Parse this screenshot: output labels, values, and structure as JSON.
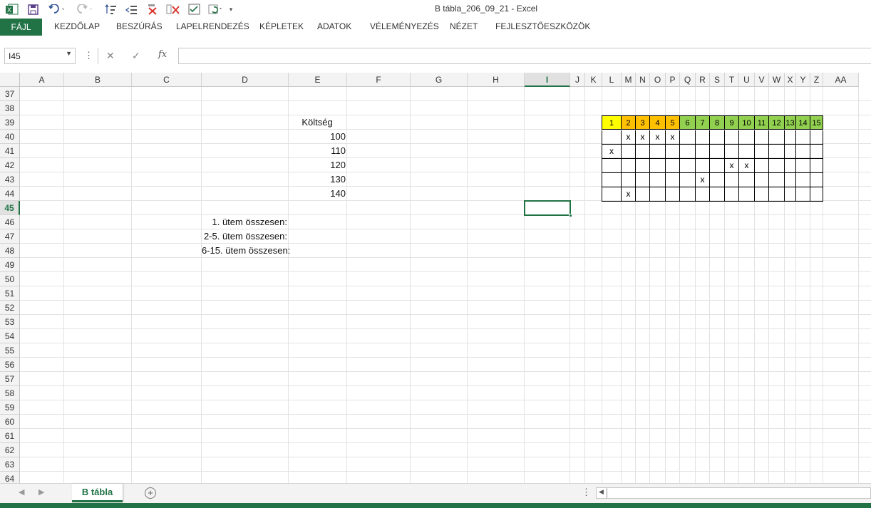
{
  "window": {
    "title": "B tábla_206_09_21 - Excel"
  },
  "ribbon": {
    "file_tab": "FÁJL",
    "tabs": [
      "KEZDŐLAP",
      "BESZÚRÁS",
      "LAPELRENDEZÉS",
      "KÉPLETEK",
      "ADATOK",
      "VÉLEMÉNYEZÉS",
      "NÉZET",
      "FEJLESZTŐESZKÖZÖK"
    ]
  },
  "quick_access": [
    "excel-logo-icon",
    "save-icon",
    "undo-icon",
    "redo-icon",
    "sort-icon",
    "indent-icon",
    "delete-icon",
    "delete-icon",
    "checklist-icon",
    "refresh-icon",
    "more-icon"
  ],
  "formula_bar": {
    "name_box": "I45",
    "fx": "fx",
    "formula": ""
  },
  "columns": [
    "A",
    "B",
    "C",
    "D",
    "E",
    "F",
    "G",
    "H",
    "I",
    "J",
    "K",
    "L",
    "M",
    "N",
    "O",
    "P",
    "Q",
    "R",
    "S",
    "T",
    "U",
    "V",
    "W",
    "X",
    "Y",
    "Z",
    "AA"
  ],
  "selected_column": "I",
  "rows": [
    37,
    38,
    39,
    40,
    41,
    42,
    43,
    44,
    45,
    46,
    47,
    48,
    49,
    50,
    51,
    52,
    53,
    54,
    55,
    56,
    57,
    58,
    59,
    60,
    61,
    62,
    63,
    64
  ],
  "selected_row": 45,
  "selected_cell": "I45",
  "cells": {
    "E39": "Költség",
    "E40": "100",
    "E41": "110",
    "E42": "120",
    "E43": "130",
    "E44": "140",
    "D46": "1. ütem összesen:",
    "D47": "2-5. ütem összesen:",
    "D48": "6-15. ütem összesen:"
  },
  "schedule": {
    "headers": [
      "1",
      "2",
      "3",
      "4",
      "5",
      "6",
      "7",
      "8",
      "9",
      "10",
      "11",
      "12",
      "13",
      "14",
      "15"
    ],
    "header_colors": [
      "#ffff00",
      "#ffc000",
      "#ffc000",
      "#ffc000",
      "#ffc000",
      "#92d050",
      "#92d050",
      "#92d050",
      "#92d050",
      "#92d050",
      "#92d050",
      "#92d050",
      "#92d050",
      "#92d050",
      "#92d050"
    ],
    "marks": [
      [
        "",
        "x",
        "x",
        "x",
        "x",
        "",
        "",
        "",
        "",
        "",
        "",
        "",
        "",
        "",
        ""
      ],
      [
        "x",
        "",
        "",
        "",
        "",
        "",
        "",
        "",
        "",
        "",
        "",
        "",
        "",
        "",
        ""
      ],
      [
        "",
        "",
        "",
        "",
        "",
        "",
        "",
        "",
        "x",
        "x",
        "",
        "",
        "",
        "",
        ""
      ],
      [
        "",
        "",
        "",
        "",
        "",
        "",
        "x",
        "",
        "",
        "",
        "",
        "",
        "",
        "",
        ""
      ],
      [
        "",
        "x",
        "",
        "",
        "",
        "",
        "",
        "",
        "",
        "",
        "",
        "",
        "",
        "",
        ""
      ]
    ]
  },
  "sheets": {
    "active": "B tábla"
  }
}
